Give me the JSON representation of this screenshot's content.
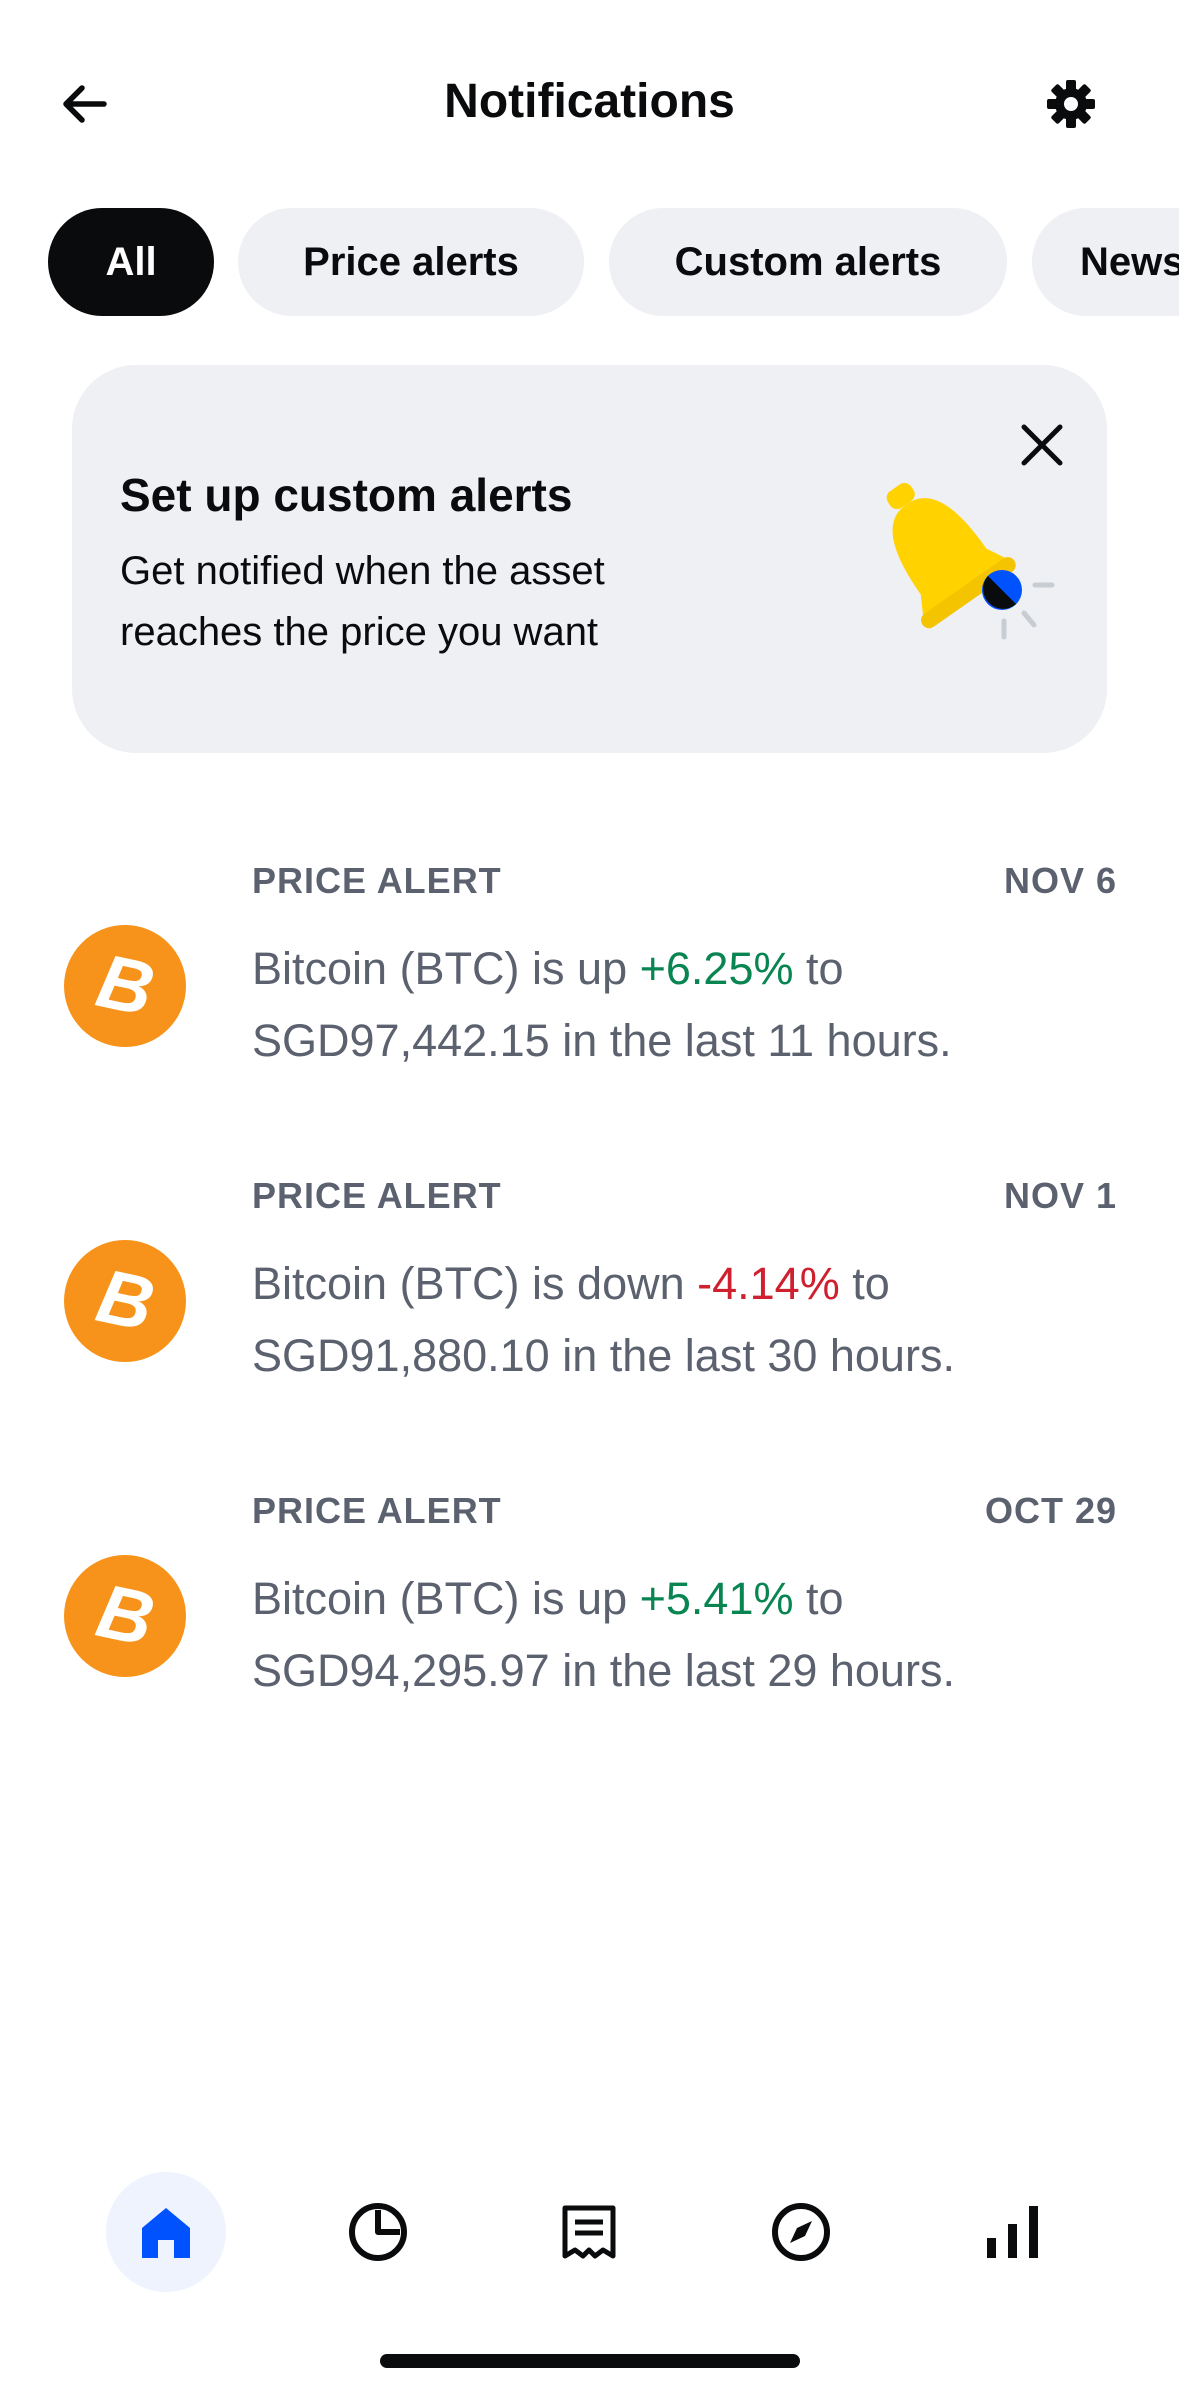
{
  "header": {
    "title": "Notifications",
    "back_icon": "arrow-left-icon",
    "settings_icon": "gear-icon"
  },
  "filters": [
    {
      "label": "All",
      "active": true
    },
    {
      "label": "Price alerts",
      "active": false
    },
    {
      "label": "Custom alerts",
      "active": false
    },
    {
      "label": "News",
      "active": false
    }
  ],
  "promo": {
    "title": "Set up custom alerts",
    "description": "Get notified when the asset reaches the price you want",
    "close_icon": "close-icon",
    "art_icon": "bell-illustration"
  },
  "notifications": [
    {
      "type": "PRICE ALERT",
      "date": "NOV 6",
      "icon": "bitcoin-icon",
      "prefix": "Bitcoin (BTC) is up ",
      "change": "+6.25%",
      "direction": "up",
      "suffix": " to SGD97,442.15 in the last 11 hours."
    },
    {
      "type": "PRICE ALERT",
      "date": "NOV 1",
      "icon": "bitcoin-icon",
      "prefix": "Bitcoin (BTC) is down ",
      "change": "-4.14%",
      "direction": "down",
      "suffix": " to SGD91,880.10 in the last 30 hours."
    },
    {
      "type": "PRICE ALERT",
      "date": "OCT 29",
      "icon": "bitcoin-icon",
      "prefix": "Bitcoin (BTC) is up ",
      "change": "+5.41%",
      "direction": "up",
      "suffix": " to SGD94,295.97 in the last 29 hours."
    }
  ],
  "coin_symbol": "B",
  "bottom_nav": [
    {
      "icon": "home-icon",
      "active": true
    },
    {
      "icon": "portfolio-pie-icon",
      "active": false
    },
    {
      "icon": "receipt-icon",
      "active": false
    },
    {
      "icon": "compass-icon",
      "active": false
    },
    {
      "icon": "bar-chart-icon",
      "active": false
    }
  ],
  "colors": {
    "accent": "#0052ff",
    "up": "#098551",
    "down": "#cf202f",
    "bitcoin": "#f7931a",
    "chip_bg": "#eef0f3"
  }
}
